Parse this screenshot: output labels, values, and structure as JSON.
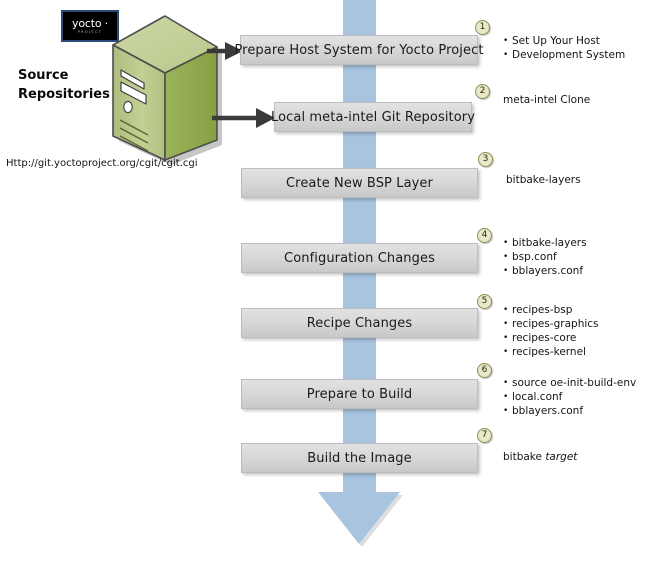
{
  "source": {
    "label_line1": "Source",
    "label_line2": "Repositories",
    "url": "Http://git.yoctoproject.org/cgit/cgit.cgi",
    "logo_main": "yocto ·",
    "logo_sub": "PROJECT",
    "server_icon": "server-tower-icon"
  },
  "colors": {
    "flow_arrow": "#a8c4de",
    "box_fill": "#d8d8d8",
    "box_border": "#bdbdbd",
    "circle_fill": "#e8e7c8",
    "circle_border": "#8f9156",
    "server_front": "#b5c585",
    "server_side": "#8aa348",
    "logo_border": "#2a4b77"
  },
  "steps": [
    {
      "number": "1",
      "box_label": "Prepare Host System for Yocto Project",
      "annotations": [
        "Set Up Your Host",
        "Development System"
      ],
      "bulleted": false
    },
    {
      "number": "2",
      "box_label": "Local meta-intel Git Repository",
      "annotations": [
        "meta-intel Clone"
      ],
      "bulleted": false
    },
    {
      "number": "3",
      "box_label": "Create New BSP Layer",
      "annotations": [
        "bitbake-layers"
      ],
      "bulleted": false
    },
    {
      "number": "4",
      "box_label": "Configuration Changes",
      "annotations": [
        "bitbake-layers",
        "bsp.conf",
        "bblayers.conf"
      ],
      "bulleted": true
    },
    {
      "number": "5",
      "box_label": "Recipe Changes",
      "annotations": [
        "recipes-bsp",
        "recipes-graphics",
        "recipes-core",
        "recipes-kernel"
      ],
      "bulleted": true
    },
    {
      "number": "6",
      "box_label": "Prepare to Build",
      "annotations": [
        "source oe-init-build-env",
        "local.conf",
        "bblayers.conf"
      ],
      "bulleted": true
    },
    {
      "number": "7",
      "box_label": "Build the Image",
      "annotations": [
        "bitbake target"
      ],
      "bulleted": false,
      "italic_tail": "target",
      "italic_head": "bitbake "
    }
  ]
}
